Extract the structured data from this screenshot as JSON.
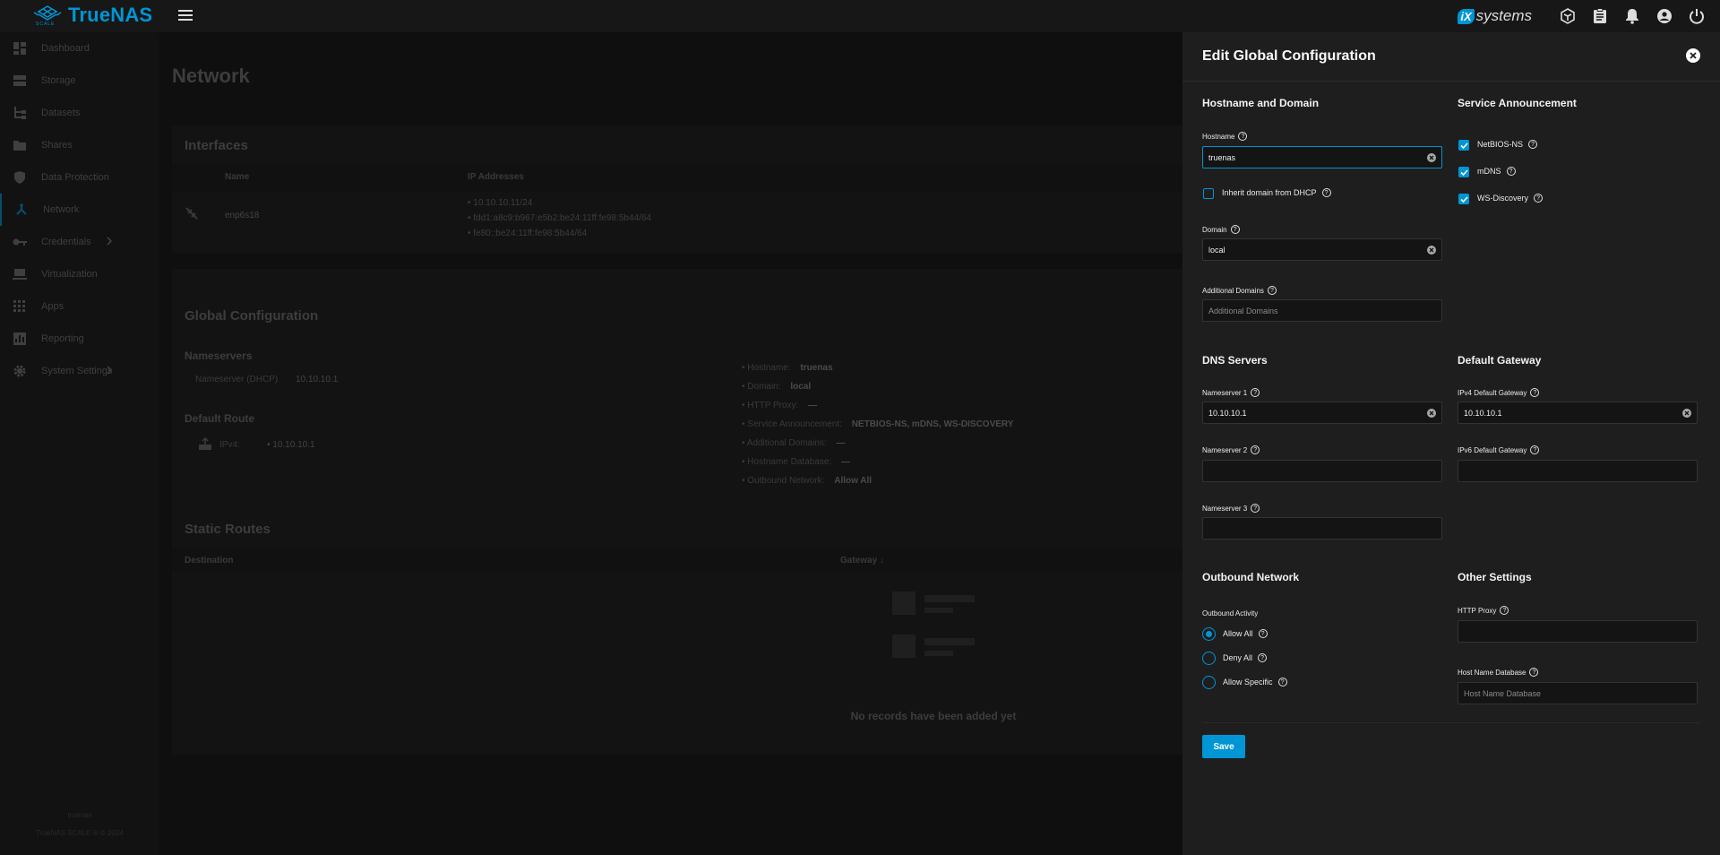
{
  "topbar": {
    "brand": "TrueNAS",
    "brand_sub": "SCALE",
    "vendor_badge": "iX",
    "vendor_text": "systems",
    "icons": [
      "truecommand-icon",
      "clipboard-icon",
      "bell-icon",
      "account-icon",
      "power-icon"
    ]
  },
  "sidebar": {
    "items": [
      {
        "label": "Dashboard",
        "icon": "dashboard-icon"
      },
      {
        "label": "Storage",
        "icon": "storage-icon"
      },
      {
        "label": "Datasets",
        "icon": "datasets-icon"
      },
      {
        "label": "Shares",
        "icon": "shares-icon"
      },
      {
        "label": "Data Protection",
        "icon": "shield-icon"
      },
      {
        "label": "Network",
        "icon": "network-icon"
      },
      {
        "label": "Credentials",
        "icon": "key-icon"
      },
      {
        "label": "Virtualization",
        "icon": "laptop-icon"
      },
      {
        "label": "Apps",
        "icon": "apps-icon"
      },
      {
        "label": "Reporting",
        "icon": "chart-icon"
      },
      {
        "label": "System Settings",
        "icon": "gear-icon"
      }
    ],
    "footer_host": "truenas",
    "footer_copyright": "TrueNAS SCALE ® © 2024"
  },
  "page": {
    "title": "Network",
    "interfaces": {
      "title": "Interfaces",
      "col_name": "Name",
      "col_ip": "IP Addresses",
      "row_name": "enp6s18",
      "ips": [
        "10.10.10.11/24",
        "fdd1:a8c9:b967:e5b2:be24:11ff:fe98:5b44/64",
        "fe80::be24:11ff:fe98:5b44/64"
      ]
    },
    "global": {
      "title": "Global Configuration",
      "nameservers_title": "Nameservers",
      "ns_label": "Nameserver (DHCP)",
      "ns_value": "10.10.10.1",
      "route_title": "Default Route",
      "ipv4_label": "IPv4:",
      "ipv4_value": "10.10.10.1",
      "summary": [
        {
          "k": "Hostname:",
          "v": "truenas"
        },
        {
          "k": "Domain:",
          "v": "local"
        },
        {
          "k": "HTTP Proxy:",
          "v": "—"
        },
        {
          "k": "Service Announcement:",
          "v": "NETBIOS-NS, mDNS, WS-DISCOVERY"
        },
        {
          "k": "Additional Domains:",
          "v": "—"
        },
        {
          "k": "Hostname Database:",
          "v": "—"
        },
        {
          "k": "Outbound Network:",
          "v": "Allow All"
        }
      ]
    },
    "static": {
      "title": "Static Routes",
      "col_dest": "Destination",
      "col_gw": "Gateway",
      "empty": "No records have been added yet"
    }
  },
  "panel": {
    "title": "Edit Global Configuration",
    "hostname_section": "Hostname and Domain",
    "hostname_label": "Hostname",
    "hostname_value": "truenas",
    "inherit_label": "Inherit domain from DHCP",
    "domain_label": "Domain",
    "domain_value": "local",
    "additional_label": "Additional Domains",
    "additional_placeholder": "Additional Domains",
    "service_section": "Service Announcement",
    "netbios_label": "NetBIOS-NS",
    "mdns_label": "mDNS",
    "wsd_label": "WS-Discovery",
    "dns_section": "DNS Servers",
    "ns1_label": "Nameserver 1",
    "ns1_value": "10.10.10.1",
    "ns2_label": "Nameserver 2",
    "ns2_value": "",
    "ns3_label": "Nameserver 3",
    "ns3_value": "",
    "gateway_section": "Default Gateway",
    "ipv4gw_label": "IPv4 Default Gateway",
    "ipv4gw_value": "10.10.10.1",
    "ipv6gw_label": "IPv6 Default Gateway",
    "ipv6gw_value": "",
    "outbound_section": "Outbound Network",
    "outbound_activity_label": "Outbound Activity",
    "radio_allow_all": "Allow All",
    "radio_deny_all": "Deny All",
    "radio_allow_specific": "Allow Specific",
    "other_section": "Other Settings",
    "http_proxy_label": "HTTP Proxy",
    "http_proxy_value": "",
    "hostdb_label": "Host Name Database",
    "hostdb_placeholder": "Host Name Database",
    "save_label": "Save"
  },
  "colors": {
    "accent": "#0095d5",
    "panel_bg": "#1e1e1e",
    "page_bg": "#0f0f0f"
  }
}
